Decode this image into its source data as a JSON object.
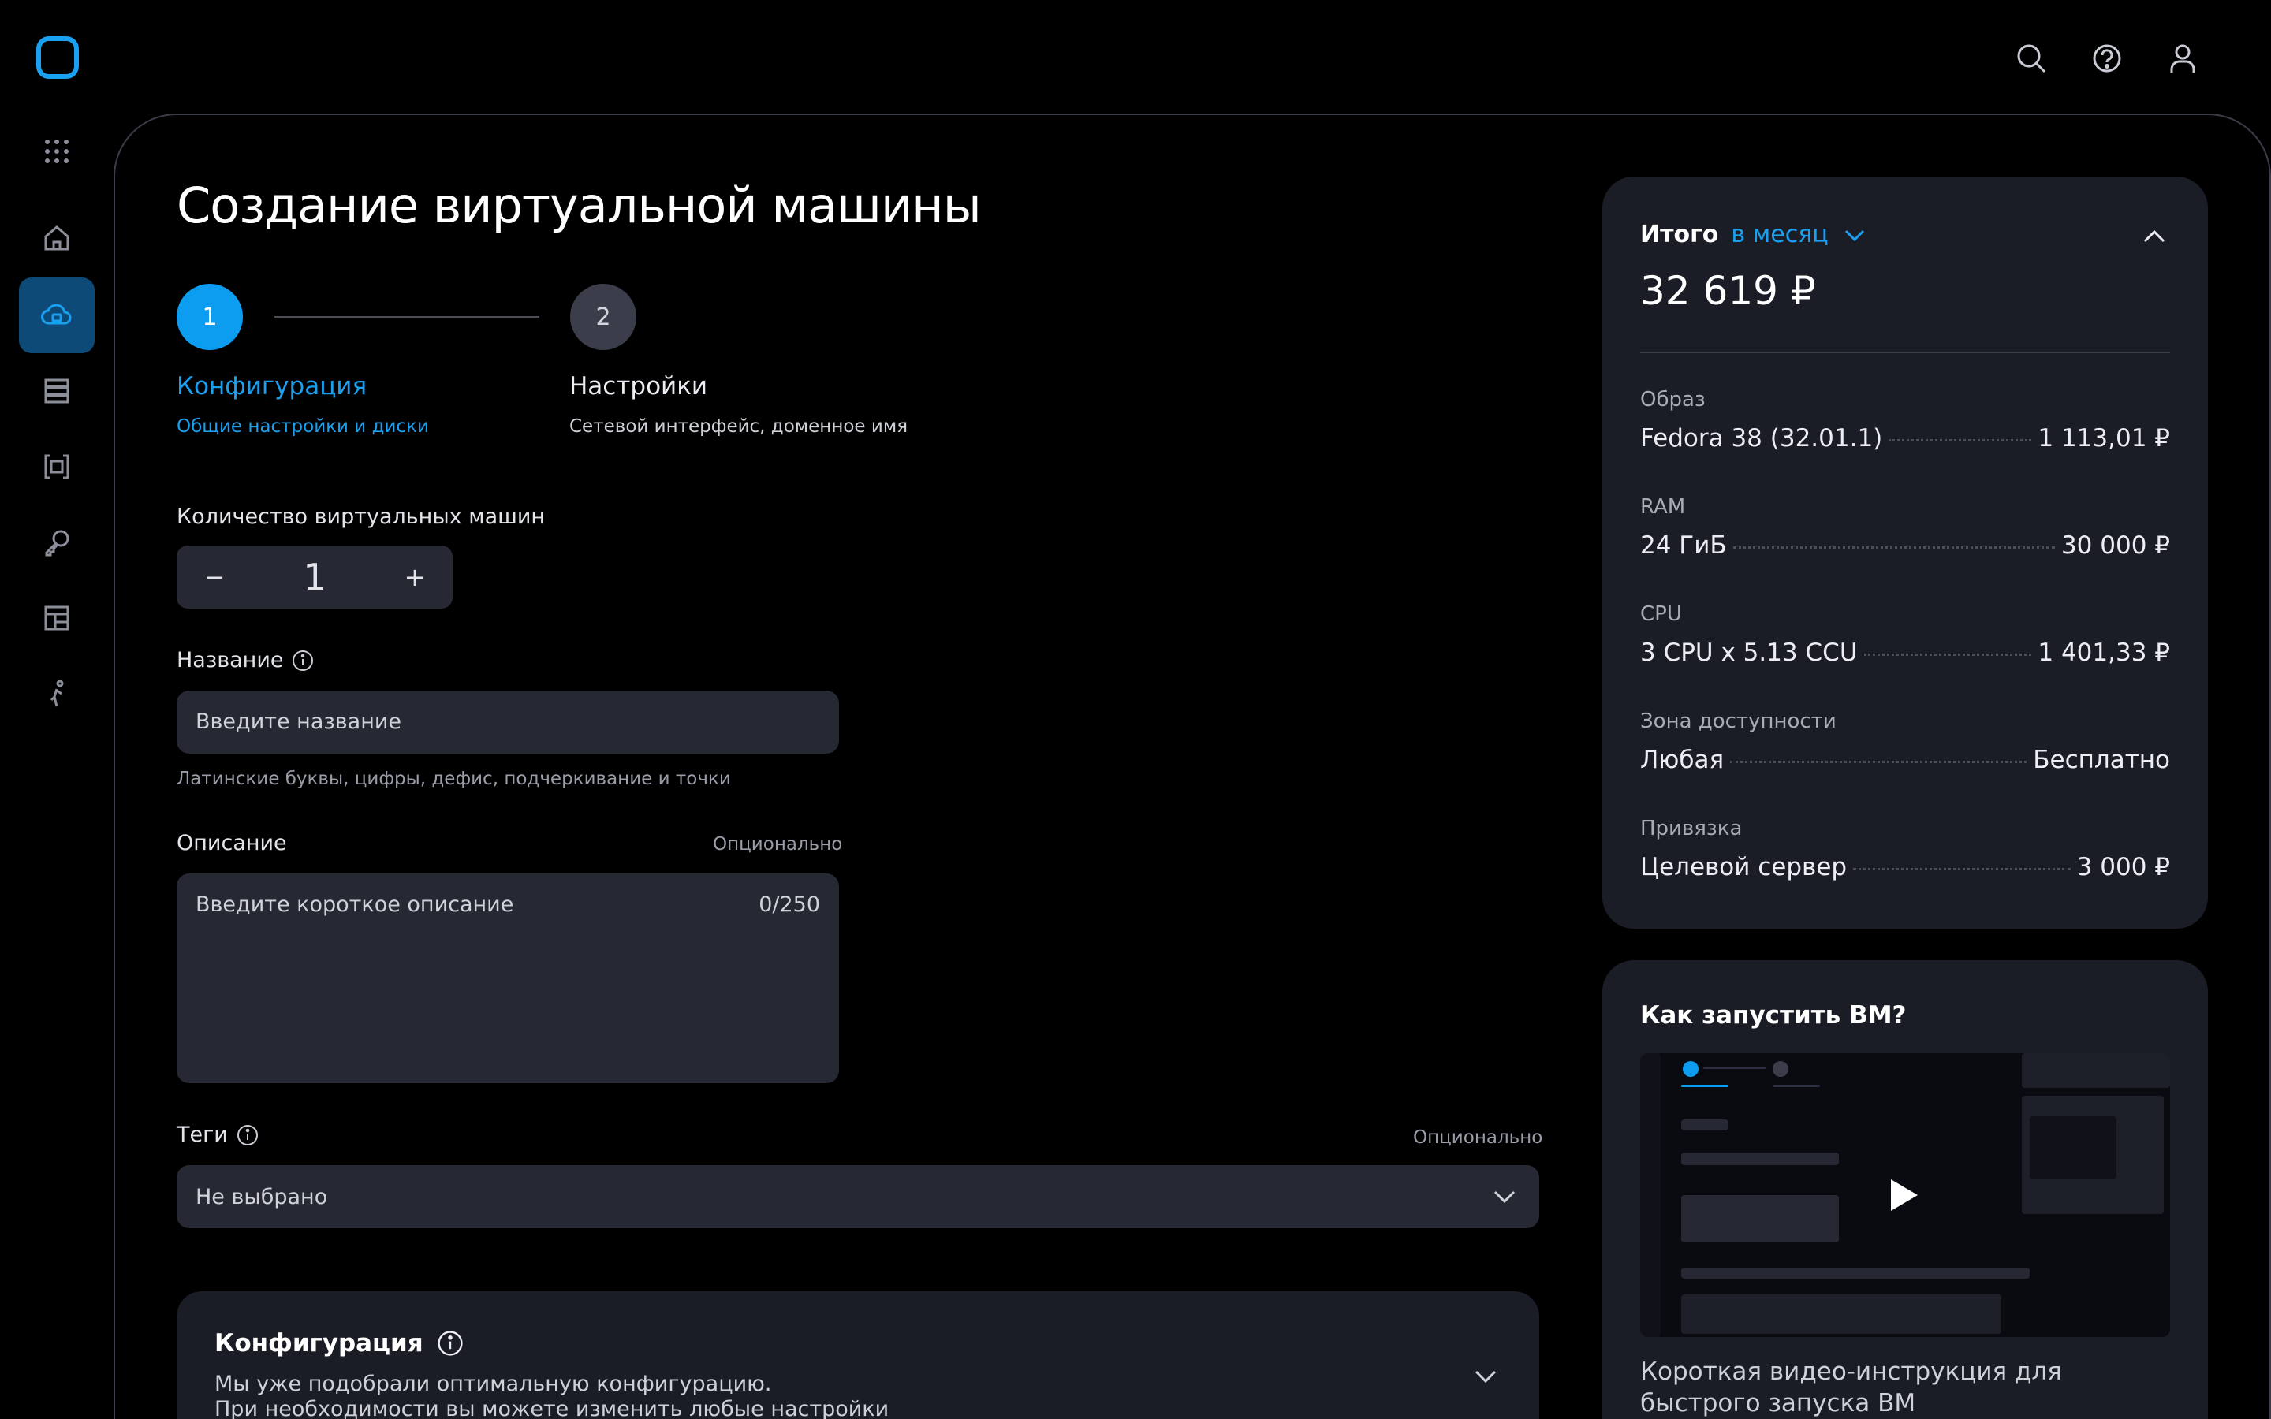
{
  "header": {
    "logo": "brand-logo",
    "icons": [
      "search-icon",
      "help-icon",
      "user-icon"
    ]
  },
  "sidebar": {
    "items": [
      {
        "icon": "apps-grid-icon"
      },
      {
        "icon": "home-icon"
      },
      {
        "icon": "cloud-compute-icon",
        "active": true
      },
      {
        "icon": "database-icon"
      },
      {
        "icon": "frame-icon"
      },
      {
        "icon": "key-wrench-icon"
      },
      {
        "icon": "layout-icon"
      },
      {
        "icon": "person-walk-icon"
      }
    ]
  },
  "page": {
    "title": "Создание виртуальной машины"
  },
  "steps": [
    {
      "number": "1",
      "title": "Конфигурация",
      "subtitle": "Общие настройки и диски",
      "active": true
    },
    {
      "number": "2",
      "title": "Настройки",
      "subtitle": "Сетевой интерфейс, доменное имя",
      "active": false
    }
  ],
  "form": {
    "count": {
      "label": "Количество виртуальных машин",
      "minus": "−",
      "value": "1",
      "plus": "+"
    },
    "name": {
      "label": "Название",
      "placeholder": "Введите название",
      "hint": "Латинские буквы, цифры, дефис, подчеркивание и точки"
    },
    "description": {
      "label": "Описание",
      "optional": "Опционально",
      "placeholder": "Введите короткое описание",
      "counter": "0/250"
    },
    "tags": {
      "label": "Теги",
      "optional": "Опционально",
      "value": "Не выбрано"
    },
    "config": {
      "title": "Конфигурация",
      "line1": "Мы уже подобрали оптимальную конфигурацию.",
      "line2": "При необходимости вы можете изменить любые настройки"
    }
  },
  "summary": {
    "title": "Итого",
    "period": "в месяц",
    "total": "32 619 ₽",
    "rows": [
      {
        "caption": "Образ",
        "name": "Fedora 38 (32.01.1)",
        "price": "1 113,01 ₽"
      },
      {
        "caption": "RAM",
        "name": "24 ГиБ",
        "price": "30 000 ₽"
      },
      {
        "caption": "CPU",
        "name": "3 CPU x 5.13 CCU",
        "price": "1 401,33 ₽"
      },
      {
        "caption": "Зона доступности",
        "name": "Любая",
        "price": "Бесплатно"
      },
      {
        "caption": "Привязка",
        "name": "Целевой сервер",
        "price": "3 000 ₽"
      }
    ]
  },
  "video": {
    "title": "Как запустить ВМ?",
    "description": "Короткая видео-инструкция для быстрого запуска ВМ"
  },
  "colors": {
    "accent": "#0c9cf0",
    "background": "#000000",
    "card": "#1b1d26",
    "input": "#262833"
  }
}
